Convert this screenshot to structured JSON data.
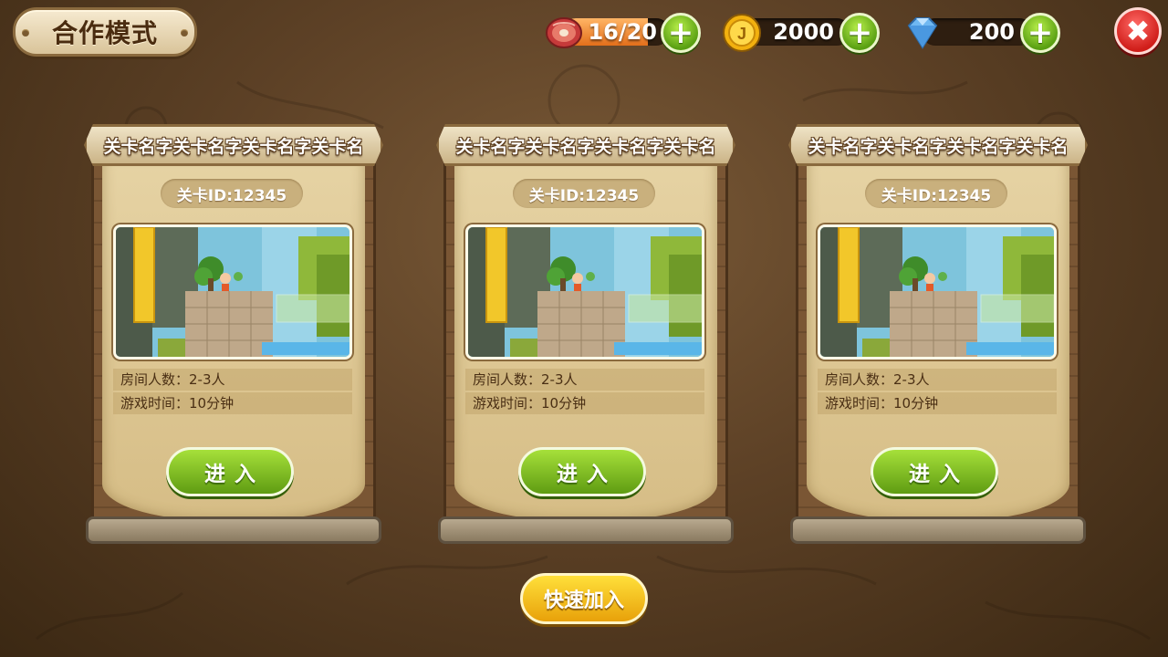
{
  "header": {
    "title": "合作模式",
    "stamina": {
      "value": "16/20",
      "fraction": 0.8
    },
    "coins": {
      "value": "2000"
    },
    "gems": {
      "value": "200"
    }
  },
  "levels": [
    {
      "name": "关卡名字关卡名字关卡名字关卡名",
      "id_label": "关卡ID:12345",
      "room_players": "房间人数：2-3人",
      "game_time": "游戏时间：10分钟",
      "enter_label": "进入"
    },
    {
      "name": "关卡名字关卡名字关卡名字关卡名",
      "id_label": "关卡ID:12345",
      "room_players": "房间人数：2-3人",
      "game_time": "游戏时间：10分钟",
      "enter_label": "进入"
    },
    {
      "name": "关卡名字关卡名字关卡名字关卡名",
      "id_label": "关卡ID:12345",
      "room_players": "房间人数：2-3人",
      "game_time": "游戏时间：10分钟",
      "enter_label": "进入"
    }
  ],
  "quick_join_label": "快速加入",
  "colors": {
    "accent_green": "#5f9c12",
    "close_red": "#d01e1a",
    "quick_yellow": "#e8a10a",
    "stamina_orange": "#e36f1b"
  }
}
